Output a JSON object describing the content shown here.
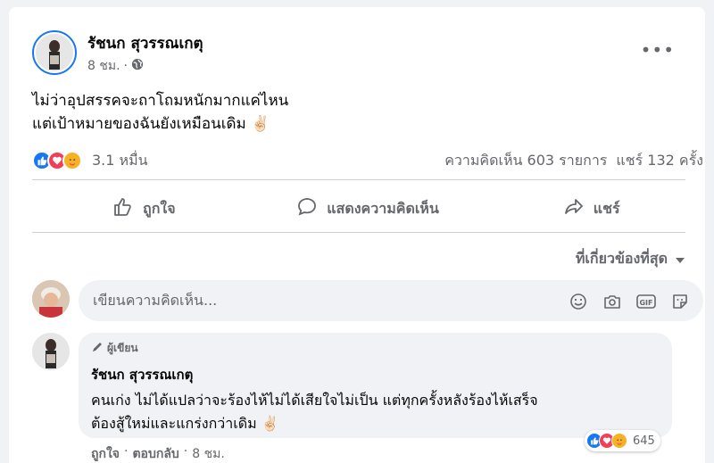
{
  "post": {
    "author": "รัชนก สุวรรณเกตุ",
    "time": "8 ชม.",
    "text_line1": "ไม่ว่าอุปสรรคจะถาโถมหนักมากแค่ไหน",
    "text_line2": "แต่เป้าหมายของฉันยังเหมือนเดิม ✌🏻",
    "reaction_count": "3.1 หมื่น",
    "comments_count": "ความคิดเห็น 603 รายการ",
    "shares_count": "แชร์ 132 ครั้ง"
  },
  "actions": {
    "like": "ถูกใจ",
    "comment": "แสดงความคิดเห็น",
    "share": "แชร์"
  },
  "sort": {
    "label": "ที่เกี่ยวข้องที่สุด"
  },
  "composer": {
    "placeholder": "เขียนความคิดเห็น..."
  },
  "comment": {
    "badge": "ผู้เขียน",
    "author": "รัชนก สุวรรณเกตุ",
    "line1": "คนเก่ง ไม่ได้แปลว่าจะร้องไห้ไม่ได้เสียใจไม่เป็น แต่ทุกครั้งหลังร้องไห้เสร็จ",
    "line2": "ต้องสู้ใหม่และแกร่งกว่าเดิม ✌🏻",
    "reaction_count": "645",
    "like": "ถูกใจ",
    "reply": "ตอบกลับ",
    "time": "8 ชม."
  },
  "colors": {
    "accent": "#1877f2",
    "love": "#f33e58",
    "care": "#f7b125",
    "muted": "#65676b"
  }
}
